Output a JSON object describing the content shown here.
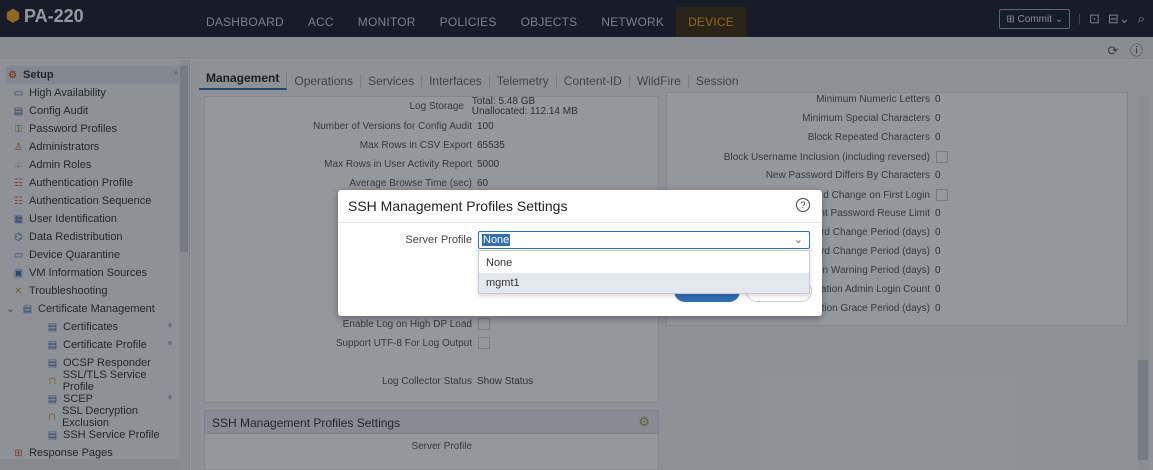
{
  "app": {
    "logo_text": "PA-220"
  },
  "nav": {
    "tabs": [
      "DASHBOARD",
      "ACC",
      "MONITOR",
      "POLICIES",
      "OBJECTS",
      "NETWORK",
      "DEVICE"
    ],
    "active": "DEVICE",
    "commit_label": "Commit"
  },
  "sidebar": {
    "items": [
      {
        "label": "Setup",
        "icon": "setup-icon",
        "active": true
      },
      {
        "label": "High Availability",
        "icon": "ha-icon"
      },
      {
        "label": "Config Audit",
        "icon": "audit-icon"
      },
      {
        "label": "Password Profiles",
        "icon": "key-icon"
      },
      {
        "label": "Administrators",
        "icon": "user-icon"
      },
      {
        "label": "Admin Roles",
        "icon": "roles-icon"
      },
      {
        "label": "Authentication Profile",
        "icon": "auth-icon"
      },
      {
        "label": "Authentication Sequence",
        "icon": "auth-seq-icon"
      },
      {
        "label": "User Identification",
        "icon": "id-icon"
      },
      {
        "label": "Data Redistribution",
        "icon": "redistribute-icon"
      },
      {
        "label": "Device Quarantine",
        "icon": "quarantine-icon"
      },
      {
        "label": "VM Information Sources",
        "icon": "vm-icon"
      },
      {
        "label": "Troubleshooting",
        "icon": "tools-icon"
      },
      {
        "label": "Certificate Management",
        "icon": "cert-mgmt-icon"
      },
      {
        "label": "Certificates",
        "icon": "cert-icon"
      },
      {
        "label": "Certificate Profile",
        "icon": "cert-profile-icon"
      },
      {
        "label": "OCSP Responder",
        "icon": "ocsp-icon"
      },
      {
        "label": "SSL/TLS Service Profile",
        "icon": "lock-icon"
      },
      {
        "label": "SCEP",
        "icon": "scep-icon"
      },
      {
        "label": "SSL Decryption Exclusion",
        "icon": "lock-icon"
      },
      {
        "label": "SSH Service Profile",
        "icon": "ssh-icon"
      },
      {
        "label": "Response Pages",
        "icon": "pages-icon"
      }
    ]
  },
  "tabs": [
    "Management",
    "Operations",
    "Services",
    "Interfaces",
    "Telemetry",
    "Content-ID",
    "WildFire",
    "Session"
  ],
  "left_panel": {
    "log_storage_label": "Log Storage",
    "log_storage_total": "Total: 5.48 GB",
    "log_storage_unalloc": "Unallocated: 112.14 MB",
    "rows": [
      {
        "label": "Number of Versions for Config Audit",
        "value": "100"
      },
      {
        "label": "Max Rows in CSV Export",
        "value": "65535"
      },
      {
        "label": "Max Rows in User Activity Report",
        "value": "5000"
      },
      {
        "label": "Average Browse Time (sec)",
        "value": "60"
      }
    ],
    "enable_high_dp": "Enable Log on High DP Load",
    "support_utf8": "Support UTF-8 For Log Output",
    "log_collector_label": "Log Collector Status",
    "log_collector_link": "Show Status"
  },
  "right_panel": {
    "rows": [
      {
        "label": "Minimum Numeric Letters",
        "value": "0"
      },
      {
        "label": "Minimum Special Characters",
        "value": "0"
      },
      {
        "label": "Block Repeated Characters",
        "value": "0"
      },
      {
        "label": "Block Username Inclusion (including reversed)",
        "value": ""
      },
      {
        "label": "New Password Differs By Characters",
        "value": "0"
      },
      {
        "label": "rd Change on First Login",
        "value": ""
      },
      {
        "label": "nt Password Reuse Limit",
        "value": "0"
      },
      {
        "label": "ord Change Period (days)",
        "value": "0"
      },
      {
        "label": "ord Change Period (days)",
        "value": "0"
      },
      {
        "label": "on Warning Period (days)",
        "value": "0"
      },
      {
        "label": "ation Admin Login Count",
        "value": "0"
      },
      {
        "label": "ation Grace Period (days)",
        "value": "0"
      }
    ]
  },
  "ssh_section": {
    "title": "SSH Management Profiles Settings",
    "server_profile_label": "Server Profile"
  },
  "modal": {
    "title": "SSH Management Profiles Settings",
    "field_label": "Server Profile",
    "selected": "None",
    "options": [
      "None",
      "mgmt1"
    ]
  }
}
